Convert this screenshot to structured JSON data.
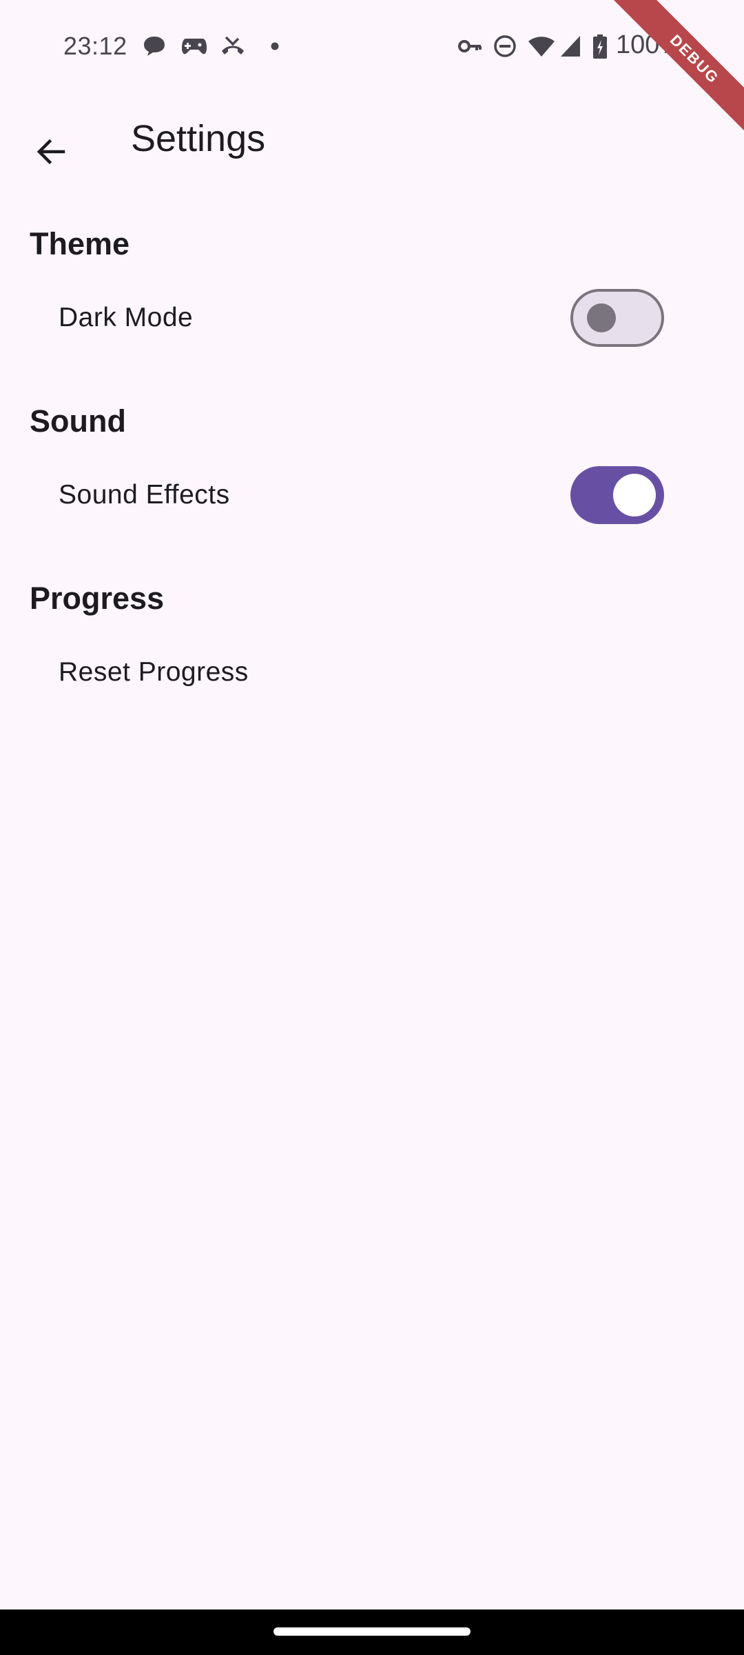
{
  "status_bar": {
    "time": "23:12",
    "notification_icons": [
      "chat-bubble-icon",
      "game-controller-icon",
      "missed-call-icon",
      "dot-icon"
    ],
    "system_icons": [
      "vpn-key-icon",
      "do-not-disturb-icon",
      "wifi-icon",
      "cell-signal-icon",
      "battery-charging-icon"
    ],
    "battery": "100%"
  },
  "debug_banner": {
    "label": "DEBUG",
    "color": "#b7474a"
  },
  "app_bar": {
    "title": "Settings",
    "back_icon": "arrow-back-icon"
  },
  "sections": [
    {
      "heading": "Theme",
      "items": [
        {
          "label": "Dark Mode",
          "control": "switch",
          "value": false
        }
      ]
    },
    {
      "heading": "Sound",
      "items": [
        {
          "label": "Sound Effects",
          "control": "switch",
          "value": true
        }
      ]
    },
    {
      "heading": "Progress",
      "items": [
        {
          "label": "Reset Progress",
          "control": "action"
        }
      ]
    }
  ],
  "colors": {
    "background": "#fdf7fd",
    "accent": "#6750a4",
    "switch_off_track": "#e7e0ec",
    "switch_off_outline": "#79747e"
  }
}
